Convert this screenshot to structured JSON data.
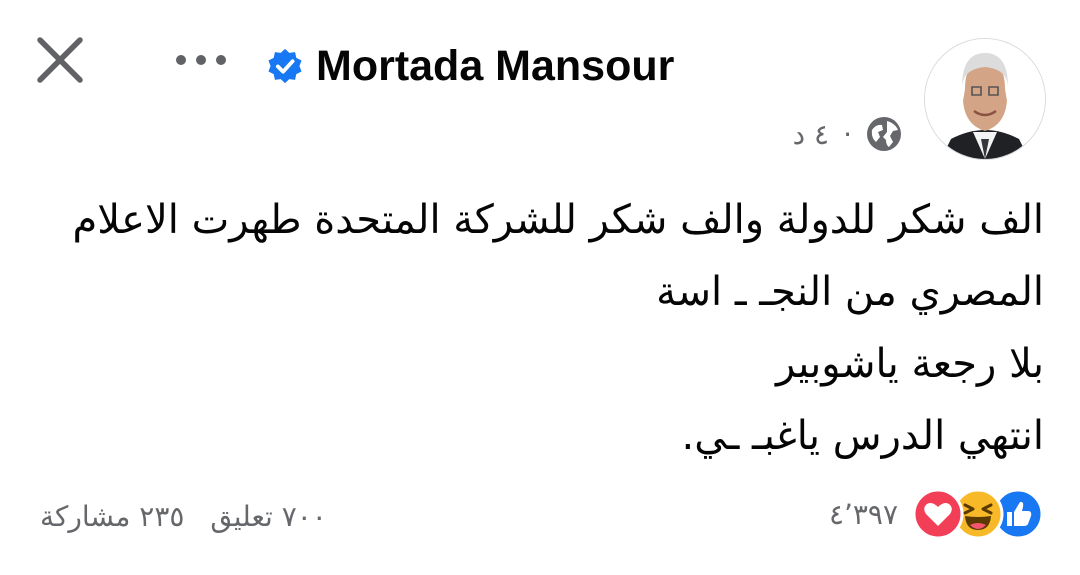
{
  "header": {
    "author_name": "Mortada Mansour",
    "verified": true,
    "close_icon": "close-icon",
    "more_icon": "more-options-icon"
  },
  "post_meta": {
    "time": "٤ د",
    "separator": "·",
    "audience_icon": "globe-icon"
  },
  "post": {
    "lines": [
      "الف شكر للدولة والف شكر للشركة المتحدة طهرت الاعلام",
      "المصري من النجـ ـ اسة",
      "بلا رجعة ياشوبير",
      "انتهي الدرس ياغبـ ـي."
    ]
  },
  "reactions": {
    "icons": [
      "like-icon",
      "haha-icon",
      "love-icon"
    ],
    "count": "٤٬٣٩٧"
  },
  "stats": {
    "comments": "٧٠٠ تعليق",
    "shares": "٢٣٥ مشاركة"
  },
  "colors": {
    "verified_blue": "#1877f2",
    "like_blue": "#1877f2",
    "haha_yellow": "#f7b928",
    "love_red": "#f33e58",
    "secondary_text": "#65676b"
  }
}
